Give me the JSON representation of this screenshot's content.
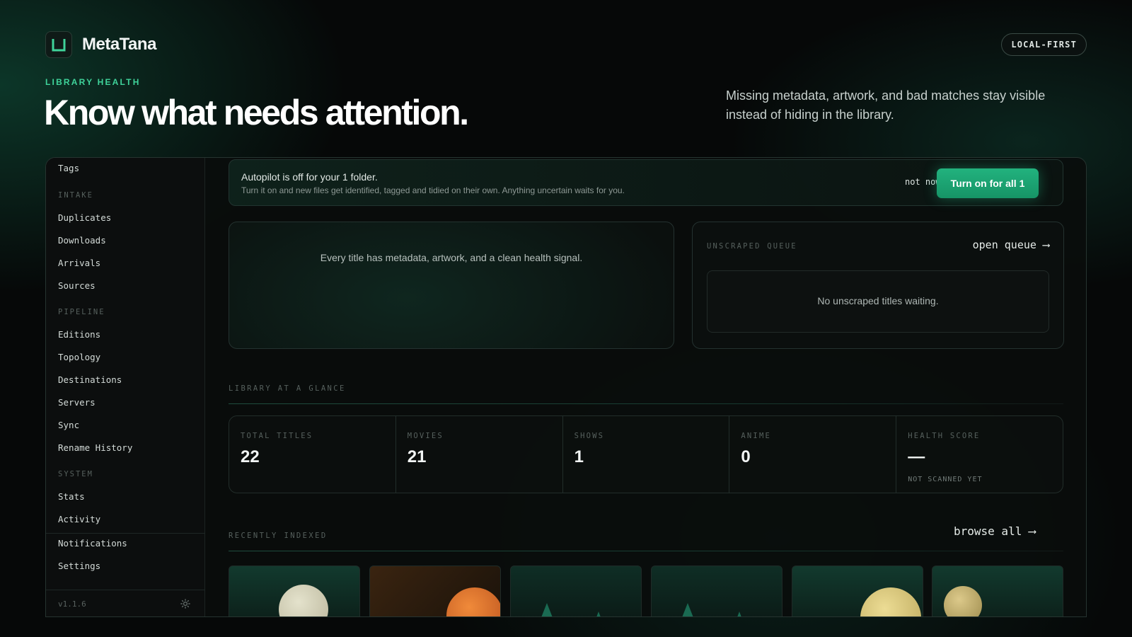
{
  "app": {
    "name": "MetaTana",
    "badge": "LOCAL-FIRST"
  },
  "hero": {
    "eyebrow": "LIBRARY HEALTH",
    "title": "Know what needs attention.",
    "subtitle": "Missing metadata, artwork, and bad matches stay visible instead of hiding in the library."
  },
  "sidebar": {
    "top_item": "Tags",
    "sections": [
      {
        "label": "INTAKE",
        "items": [
          "Duplicates",
          "Downloads",
          "Arrivals",
          "Sources"
        ]
      },
      {
        "label": "PIPELINE",
        "items": [
          "Editions",
          "Topology",
          "Destinations",
          "Servers",
          "Sync",
          "Rename History"
        ]
      },
      {
        "label": "SYSTEM",
        "items": [
          "Stats",
          "Activity"
        ]
      }
    ],
    "bottom_items": [
      "Notifications",
      "Settings"
    ],
    "version": "v1.1.6"
  },
  "banner": {
    "title": "Autopilot is off for your 1 folder.",
    "subtitle": "Turn it on and new files get identified, tagged and tidied on their own. Anything uncertain waits for you.",
    "dismiss_label": "not now",
    "action_label": "Turn on for all 1"
  },
  "health_card": {
    "text": "Every title has metadata, artwork, and a clean health signal."
  },
  "queue_card": {
    "label": "UNSCRAPED QUEUE",
    "link": "open queue ⟶",
    "empty_text": "No unscraped titles waiting."
  },
  "glance": {
    "label": "LIBRARY AT A GLANCE",
    "stats": [
      {
        "label": "TOTAL TITLES",
        "value": "22"
      },
      {
        "label": "MOVIES",
        "value": "21"
      },
      {
        "label": "SHOWS",
        "value": "1"
      },
      {
        "label": "ANIME",
        "value": "0"
      },
      {
        "label": "HEALTH SCORE",
        "value": "—",
        "note": "NOT SCANNED YET"
      }
    ]
  },
  "recent": {
    "label": "RECENTLY INDEXED",
    "link": "browse all ⟶"
  },
  "colors": {
    "accent": "#22b27e",
    "eyebrow": "#3fd39a"
  }
}
